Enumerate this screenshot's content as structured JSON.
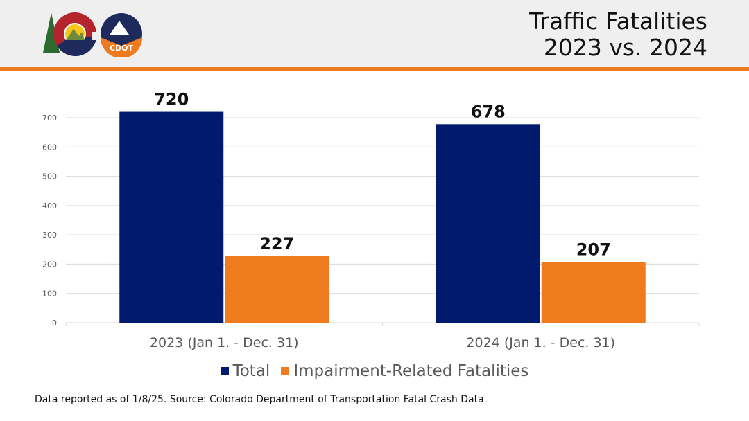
{
  "header": {
    "title_line1": "Traffic Fatalities",
    "title_line2": "2023 vs. 2024",
    "logos": [
      "Colorado state logo",
      "CDOT"
    ]
  },
  "chart_data": {
    "type": "bar",
    "title": "",
    "categories": [
      "2023 (Jan 1. - Dec. 31)",
      "2024 (Jan 1. - Dec. 31)"
    ],
    "series": [
      {
        "name": "Total",
        "color": "#001a6e",
        "values": [
          720,
          678
        ]
      },
      {
        "name": "Impairment-Related Fatalities",
        "color": "#ef7b1f",
        "values": [
          227,
          207
        ]
      }
    ],
    "yticks": [
      0,
      100,
      200,
      300,
      400,
      500,
      600,
      700
    ],
    "ylim": [
      0,
      700
    ],
    "grid": true,
    "legend": "bottom",
    "data_labels": true
  },
  "footnote": "Data reported as of 1/8/25. Source: Colorado Department of Transportation Fatal Crash Data"
}
